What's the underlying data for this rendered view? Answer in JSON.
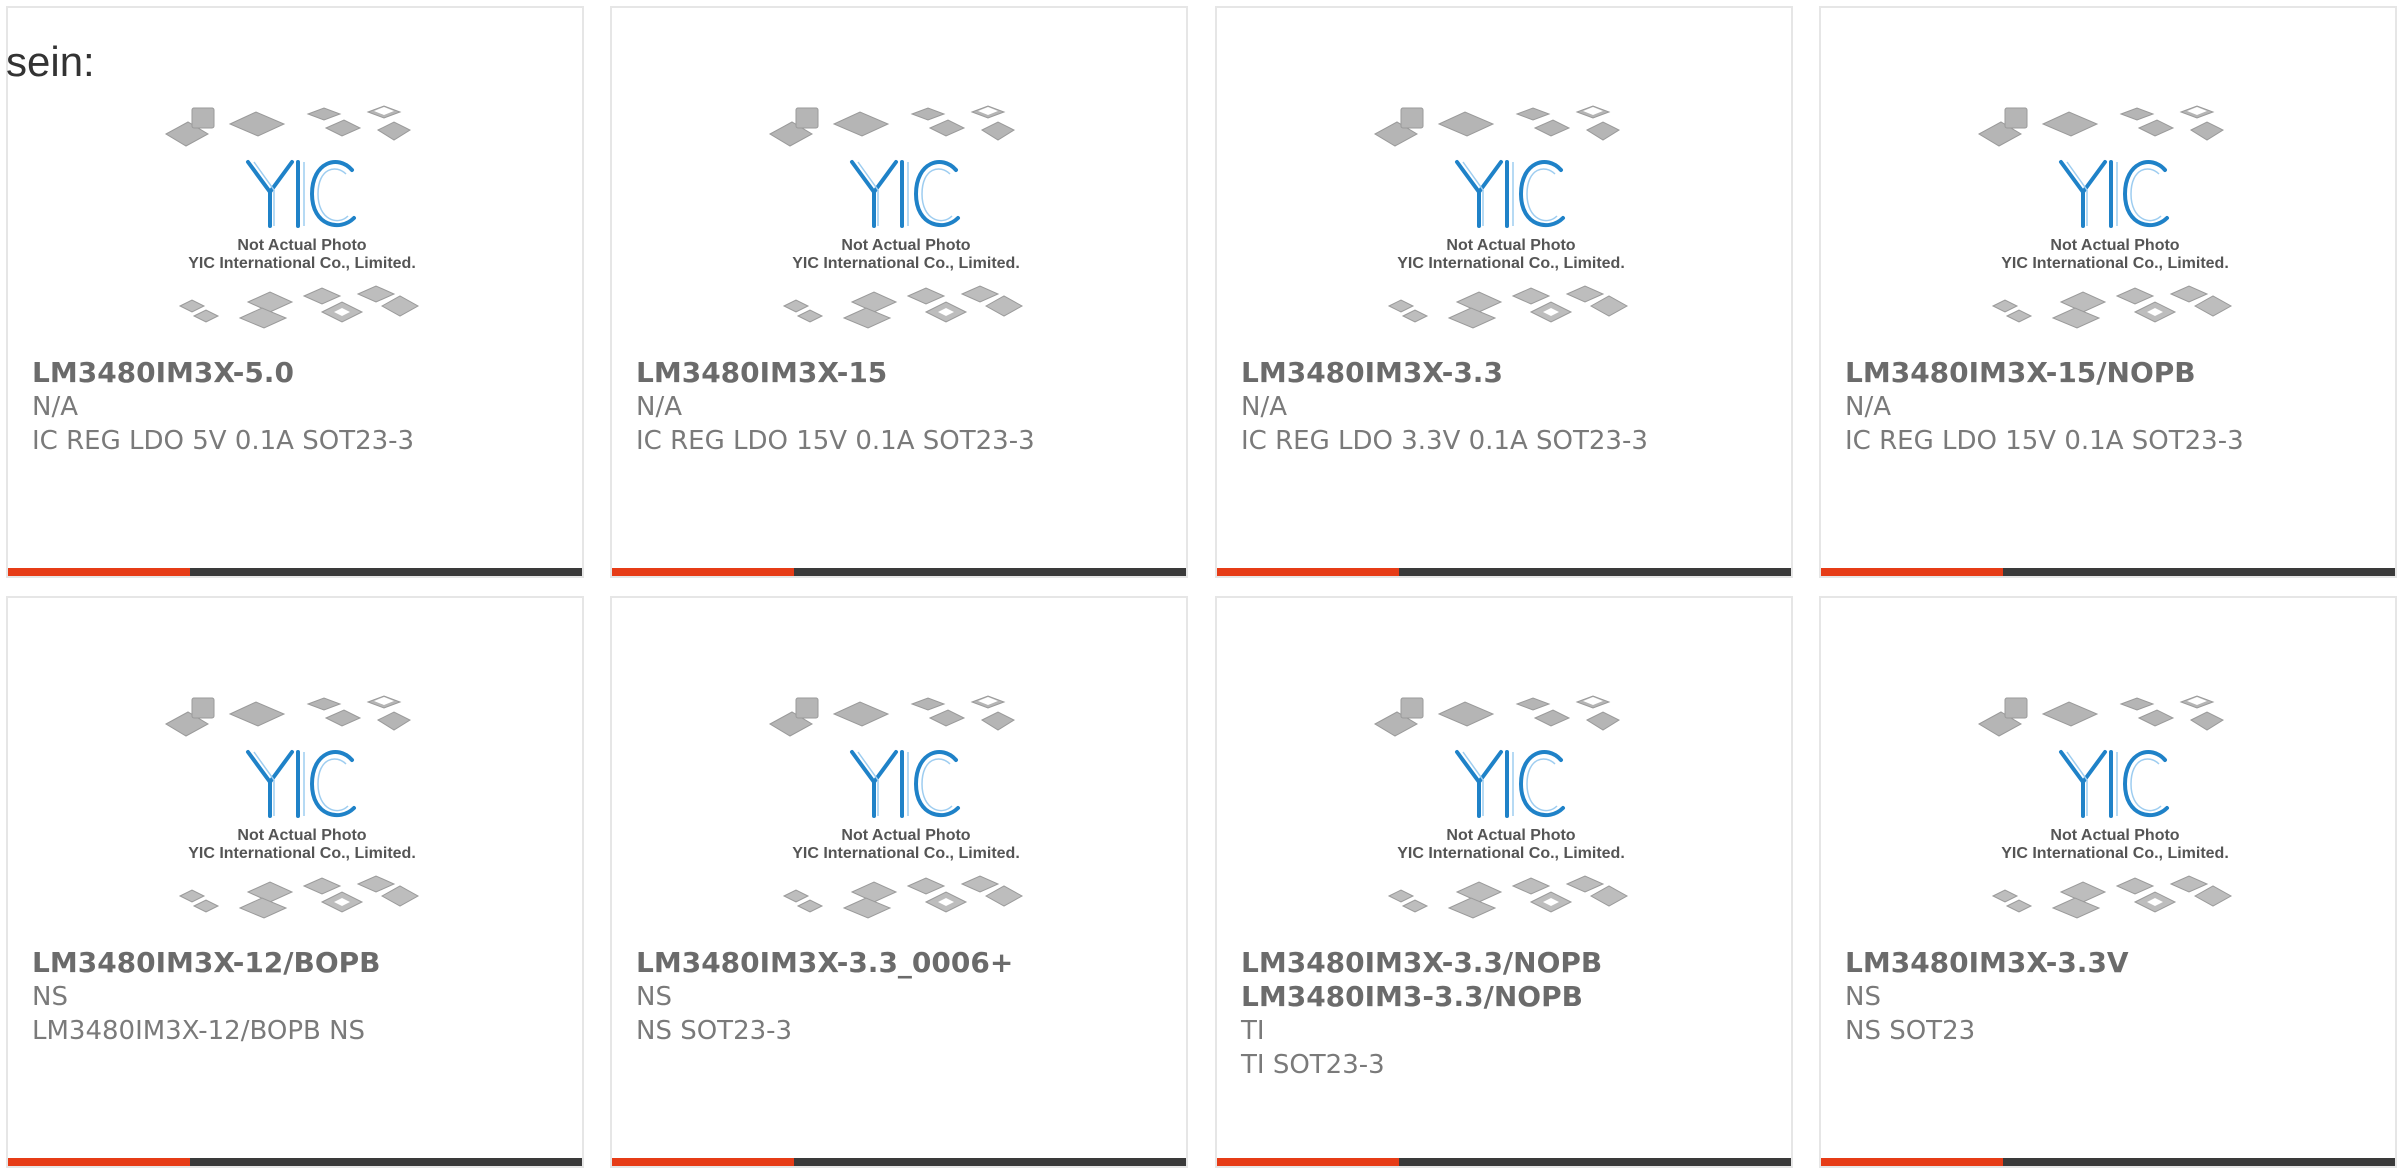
{
  "page": {
    "heading": "sein:"
  },
  "colors": {
    "accent": "#e63c17",
    "bar_dark": "#3a3a3a",
    "logo_blue": "#1f82c8"
  },
  "photo": {
    "icon": "yic-placeholder-photo",
    "line1": "Not Actual Photo",
    "line2": "YIC International Co., Limited."
  },
  "products": [
    {
      "part_number": "LM3480IM3X-5.0",
      "part_number_2": "",
      "manufacturer": "N/A",
      "description": "IC REG LDO 5V 0.1A SOT23-3"
    },
    {
      "part_number": "LM3480IM3X-15",
      "part_number_2": "",
      "manufacturer": "N/A",
      "description": "IC REG LDO 15V 0.1A SOT23-3"
    },
    {
      "part_number": "LM3480IM3X-3.3",
      "part_number_2": "",
      "manufacturer": "N/A",
      "description": "IC REG LDO 3.3V 0.1A SOT23-3"
    },
    {
      "part_number": "LM3480IM3X-15/NOPB",
      "part_number_2": "",
      "manufacturer": "N/A",
      "description": "IC REG LDO 15V 0.1A SOT23-3"
    },
    {
      "part_number": "LM3480IM3X-12/BOPB",
      "part_number_2": "",
      "manufacturer": "NS",
      "description": "LM3480IM3X-12/BOPB NS"
    },
    {
      "part_number": "LM3480IM3X-3.3_0006+",
      "part_number_2": "",
      "manufacturer": "NS",
      "description": "NS SOT23-3"
    },
    {
      "part_number": "LM3480IM3X-3.3/NOPB",
      "part_number_2": "LM3480IM3-3.3/NOPB",
      "manufacturer": "TI",
      "description": "TI SOT23-3"
    },
    {
      "part_number": "LM3480IM3X-3.3V",
      "part_number_2": "",
      "manufacturer": "NS",
      "description": "NS SOT23"
    }
  ]
}
